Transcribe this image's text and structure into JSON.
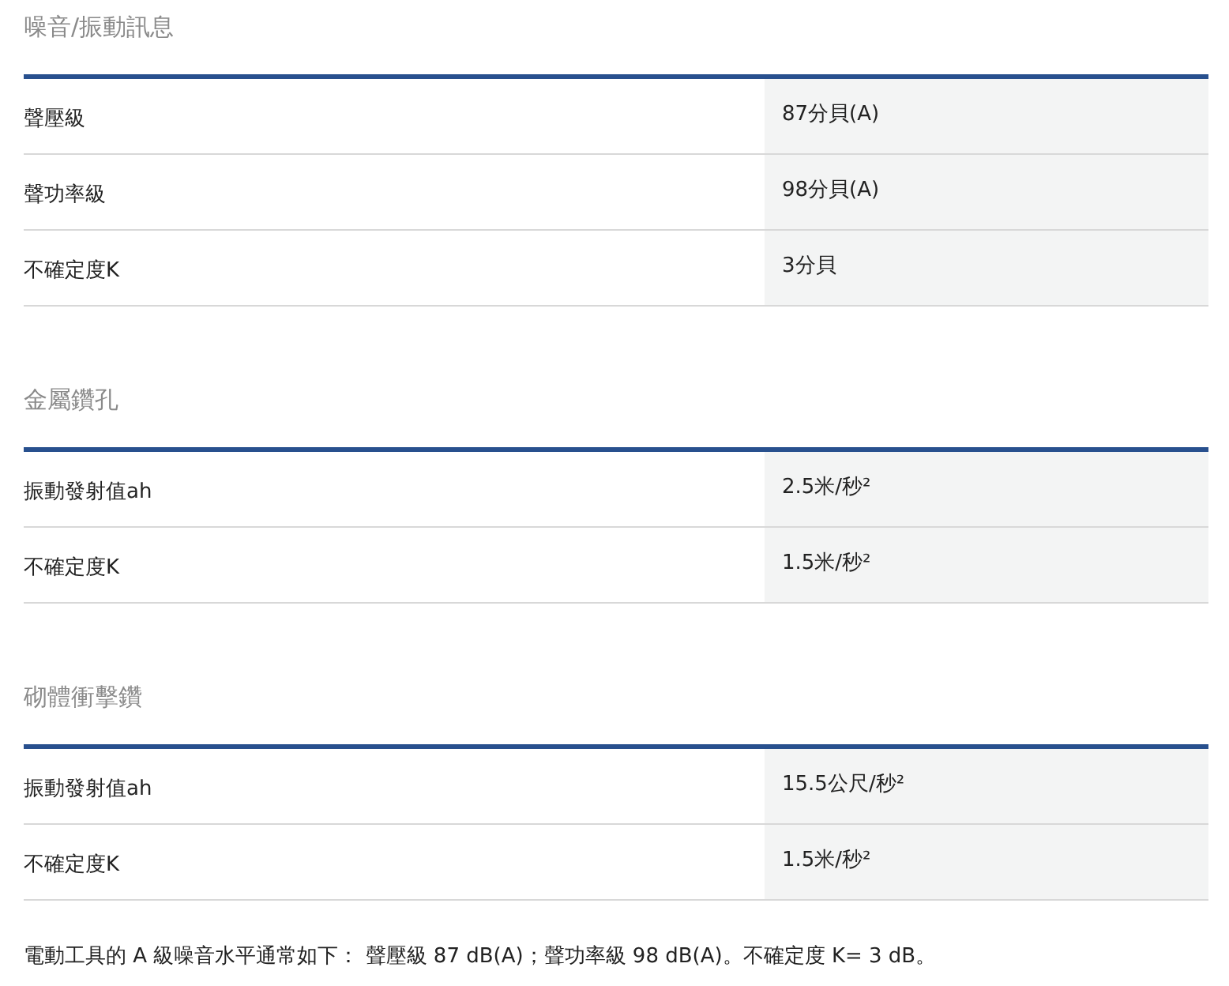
{
  "sections": [
    {
      "title": "噪音/振動訊息",
      "rows": [
        {
          "label": "聲壓級",
          "value": "87分貝(A)"
        },
        {
          "label": "聲功率級",
          "value": "98分貝(A)"
        },
        {
          "label": "不確定度K",
          "value": "3分貝"
        }
      ]
    },
    {
      "title": "金屬鑽孔",
      "rows": [
        {
          "label": "振動發射值ah",
          "value": "2.5米/秒²"
        },
        {
          "label": "不確定度K",
          "value": "1.5米/秒²"
        }
      ]
    },
    {
      "title": "砌體衝擊鑽",
      "rows": [
        {
          "label": "振動發射值ah",
          "value": "15.5公尺/秒²"
        },
        {
          "label": "不確定度K",
          "value": "1.5米/秒²"
        }
      ]
    }
  ],
  "note": "電動工具的 A 級噪音水平通常如下： 聲壓級 87 dB(A)；聲功率級 98 dB(A)。不確定度 K= 3 dB。"
}
